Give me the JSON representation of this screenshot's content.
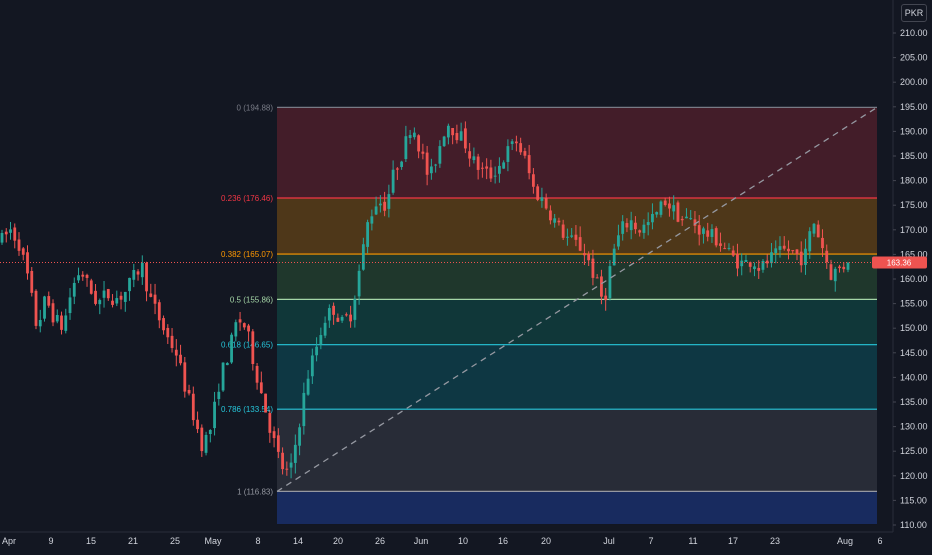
{
  "currency": "PKR",
  "colors": {
    "background": "#131722",
    "up": "#26a69a",
    "down": "#ef5350",
    "current_price": "#ef5350",
    "trend_line": "#9598a1"
  },
  "current_price_label": "163.36",
  "chart_data": {
    "type": "candlestick",
    "x_ticks": [
      "Apr",
      "9",
      "15",
      "21",
      "25",
      "May",
      "8",
      "14",
      "20",
      "26",
      "Jun",
      "10",
      "16",
      "20",
      "Jul",
      "7",
      "11",
      "17",
      "23",
      "Aug",
      "6"
    ],
    "y_ticks": [
      "110.00",
      "115.00",
      "120.00",
      "125.00",
      "130.00",
      "135.00",
      "140.00",
      "145.00",
      "150.00",
      "155.00",
      "160.00",
      "165.00",
      "170.00",
      "175.00",
      "180.00",
      "185.00",
      "190.00",
      "195.00",
      "200.00",
      "205.00",
      "210.00"
    ],
    "ylim": [
      109,
      213
    ],
    "current_price": 163.36,
    "fib_retracement": {
      "high": 194.88,
      "low": 116.83,
      "levels": [
        {
          "label": "0 (194.88)",
          "value": 194.88,
          "color": "#787b86",
          "fill": "rgba(242,54,69,0.22)"
        },
        {
          "label": "0.236 (176.46)",
          "value": 176.46,
          "color": "#f23645",
          "fill": "rgba(255,152,0,0.25)"
        },
        {
          "label": "0.382 (165.07)",
          "value": 165.07,
          "color": "#ff9800",
          "fill": "rgba(76,175,80,0.22)"
        },
        {
          "label": "0.5 (155.86)",
          "value": 155.86,
          "color": "#a5d6a7",
          "fill": "rgba(8,153,129,0.25)"
        },
        {
          "label": "0.618 (146.65)",
          "value": 146.65,
          "color": "#26c6da",
          "fill": "rgba(0,151,167,0.25)"
        },
        {
          "label": "0.786 (133.54)",
          "value": 133.54,
          "color": "#26c6da",
          "fill": "rgba(120,123,134,0.22)"
        },
        {
          "label": "1 (116.83)",
          "value": 116.83,
          "color": "#9598a1",
          "fill": "rgba(41,98,255,0.28)"
        }
      ],
      "extension_below_to": 110.2
    },
    "trend_line": {
      "from": 116.83,
      "to": 194.88
    },
    "price_path": [
      [
        0,
        168
      ],
      [
        2,
        170
      ],
      [
        4,
        167
      ],
      [
        6,
        160
      ],
      [
        8,
        150
      ],
      [
        10,
        156
      ],
      [
        12,
        152
      ],
      [
        14,
        150
      ],
      [
        16,
        158
      ],
      [
        18,
        162
      ],
      [
        20,
        158
      ],
      [
        22,
        155
      ],
      [
        24,
        157
      ],
      [
        26,
        156
      ],
      [
        28,
        157
      ],
      [
        30,
        160
      ],
      [
        32,
        163
      ],
      [
        34,
        156
      ],
      [
        36,
        152
      ],
      [
        38,
        148
      ],
      [
        40,
        145
      ],
      [
        42,
        138
      ],
      [
        44,
        132
      ],
      [
        46,
        126
      ],
      [
        48,
        130
      ],
      [
        50,
        140
      ],
      [
        52,
        145
      ],
      [
        54,
        152
      ],
      [
        56,
        150
      ],
      [
        58,
        142
      ],
      [
        60,
        135
      ],
      [
        62,
        128
      ],
      [
        64,
        122
      ],
      [
        66,
        120
      ],
      [
        68,
        130
      ],
      [
        70,
        140
      ],
      [
        72,
        146
      ],
      [
        74,
        152
      ],
      [
        76,
        154
      ],
      [
        78,
        151
      ],
      [
        80,
        153
      ],
      [
        82,
        162
      ],
      [
        84,
        172
      ],
      [
        86,
        176
      ],
      [
        88,
        175
      ],
      [
        90,
        182
      ],
      [
        92,
        186
      ],
      [
        94,
        192
      ],
      [
        96,
        186
      ],
      [
        98,
        180
      ],
      [
        100,
        186
      ],
      [
        102,
        192
      ],
      [
        104,
        190
      ],
      [
        106,
        188
      ],
      [
        108,
        184
      ],
      [
        110,
        182
      ],
      [
        112,
        181
      ],
      [
        114,
        183
      ],
      [
        116,
        186
      ],
      [
        118,
        188
      ],
      [
        120,
        184
      ],
      [
        122,
        178
      ],
      [
        124,
        176
      ],
      [
        126,
        173
      ],
      [
        128,
        170
      ],
      [
        130,
        168
      ],
      [
        132,
        167
      ],
      [
        134,
        165
      ],
      [
        136,
        160
      ],
      [
        138,
        155
      ],
      [
        140,
        165
      ],
      [
        142,
        170
      ],
      [
        144,
        172
      ],
      [
        146,
        170
      ],
      [
        148,
        171
      ],
      [
        150,
        173
      ],
      [
        152,
        176
      ],
      [
        154,
        174
      ],
      [
        156,
        172
      ],
      [
        158,
        172
      ],
      [
        160,
        170
      ],
      [
        162,
        169
      ],
      [
        164,
        168
      ],
      [
        166,
        166
      ],
      [
        168,
        164
      ],
      [
        170,
        163
      ],
      [
        172,
        164
      ],
      [
        174,
        162
      ],
      [
        176,
        164
      ],
      [
        178,
        165
      ],
      [
        180,
        166
      ],
      [
        182,
        165
      ],
      [
        184,
        164
      ],
      [
        186,
        172
      ],
      [
        188,
        167
      ],
      [
        190,
        161
      ],
      [
        192,
        162
      ],
      [
        194,
        163.36
      ]
    ]
  }
}
